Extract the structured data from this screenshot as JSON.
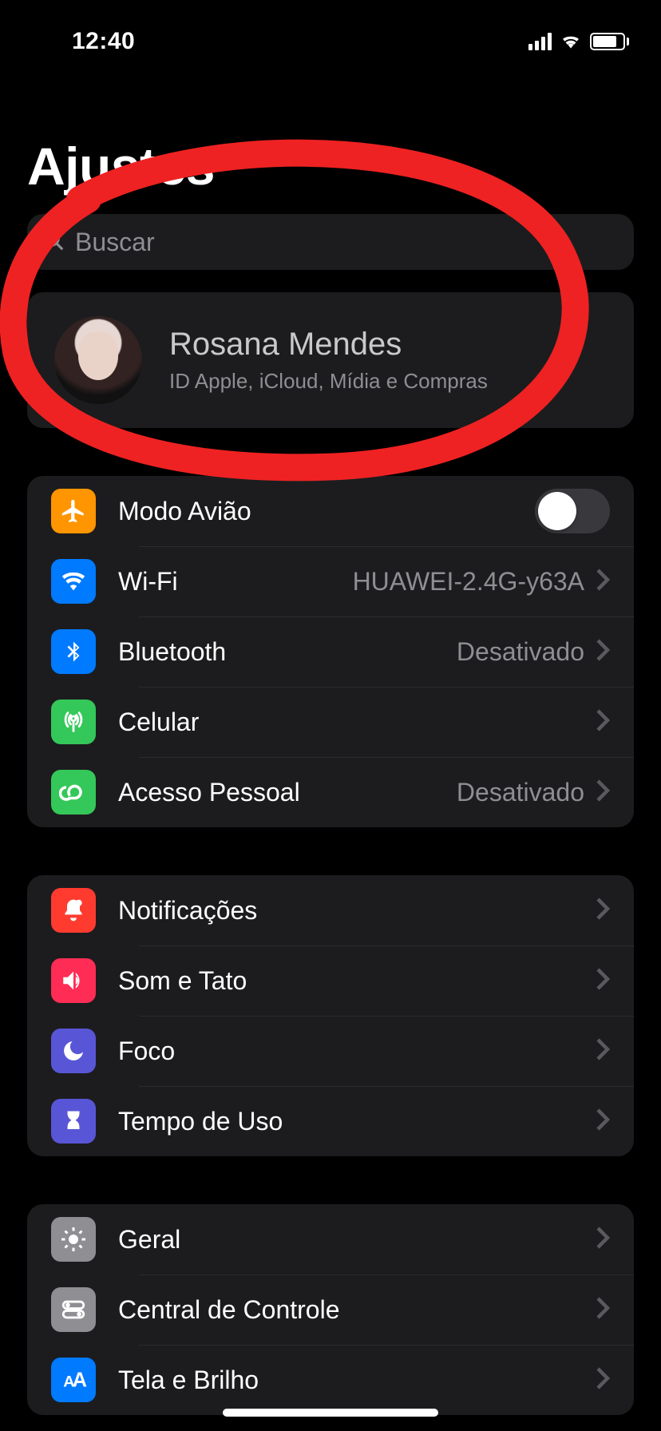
{
  "status": {
    "time": "12:40"
  },
  "title": "Ajustes",
  "search": {
    "placeholder": "Buscar"
  },
  "profile": {
    "name": "Rosana Mendes",
    "subtitle": "ID Apple, iCloud, Mídia e Compras"
  },
  "sections": [
    {
      "rows": [
        {
          "icon": "airplane",
          "label": "Modo Avião",
          "toggle": false
        },
        {
          "icon": "wifi",
          "label": "Wi-Fi",
          "value": "HUAWEI-2.4G-y63A"
        },
        {
          "icon": "bluetooth",
          "label": "Bluetooth",
          "value": "Desativado"
        },
        {
          "icon": "cellular",
          "label": "Celular"
        },
        {
          "icon": "hotspot",
          "label": "Acesso Pessoal",
          "value": "Desativado"
        }
      ]
    },
    {
      "rows": [
        {
          "icon": "notifications",
          "label": "Notificações"
        },
        {
          "icon": "sound",
          "label": "Som e Tato"
        },
        {
          "icon": "focus",
          "label": "Foco"
        },
        {
          "icon": "screentime",
          "label": "Tempo de Uso"
        }
      ]
    },
    {
      "rows": [
        {
          "icon": "general",
          "label": "Geral"
        },
        {
          "icon": "controlcenter",
          "label": "Central de Controle"
        },
        {
          "icon": "display",
          "label": "Tela e Brilho"
        }
      ]
    }
  ],
  "iconColors": {
    "airplane": "#ff9500",
    "wifi": "#007aff",
    "bluetooth": "#007aff",
    "cellular": "#34c759",
    "hotspot": "#34c759",
    "notifications": "#ff3b30",
    "sound": "#ff2d55",
    "focus": "#5856d6",
    "screentime": "#5856d6",
    "general": "#8e8e93",
    "controlcenter": "#8e8e93",
    "display": "#007aff"
  }
}
